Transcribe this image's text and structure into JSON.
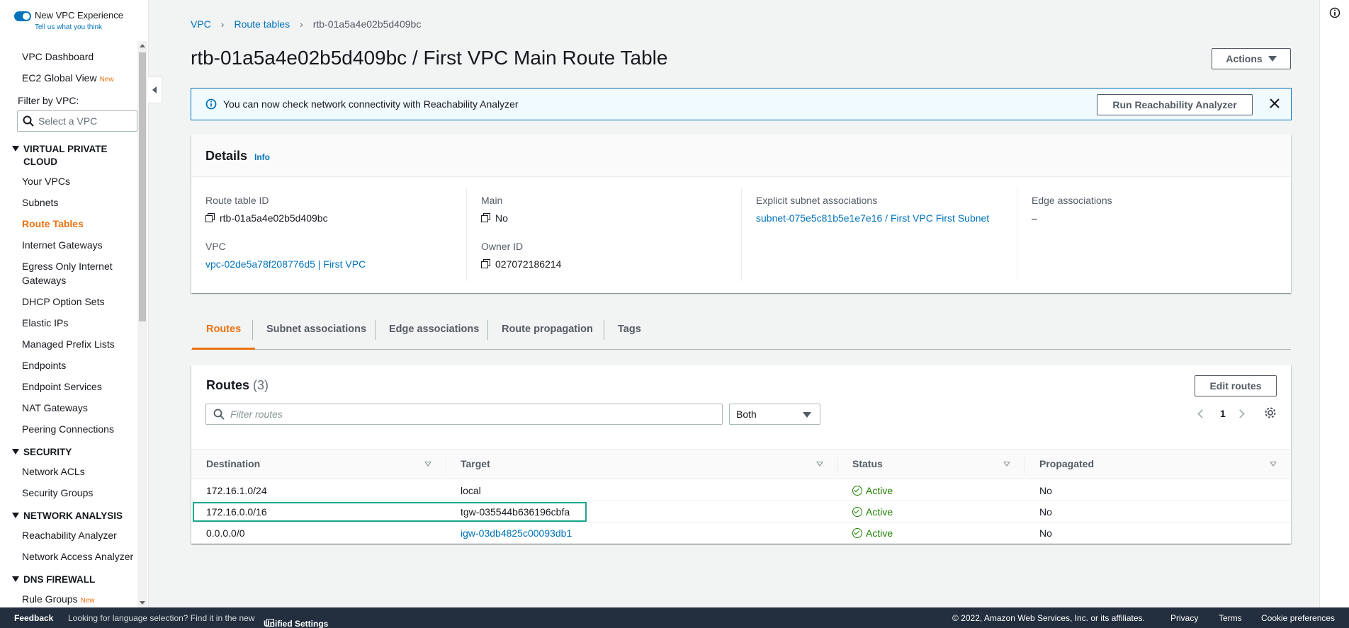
{
  "sidebar": {
    "toggle_label": "New VPC Experience",
    "toggle_sub": "Tell us what you think",
    "top_items": [
      {
        "label": "VPC Dashboard",
        "badge": ""
      },
      {
        "label": "EC2 Global View",
        "badge": "New"
      }
    ],
    "filter_label": "Filter by VPC:",
    "filter_placeholder": "Select a VPC",
    "sections": [
      {
        "title": "VIRTUAL PRIVATE CLOUD",
        "items": [
          "Your VPCs",
          "Subnets",
          "Route Tables",
          "Internet Gateways",
          "Egress Only Internet Gateways",
          "DHCP Option Sets",
          "Elastic IPs",
          "Managed Prefix Lists",
          "Endpoints",
          "Endpoint Services",
          "NAT Gateways",
          "Peering Connections"
        ]
      },
      {
        "title": "SECURITY",
        "items": [
          "Network ACLs",
          "Security Groups"
        ]
      },
      {
        "title": "NETWORK ANALYSIS",
        "items": [
          "Reachability Analyzer",
          "Network Access Analyzer"
        ]
      },
      {
        "title": "DNS FIREWALL",
        "items": [
          "Rule Groups"
        ]
      }
    ],
    "active_item": "Route Tables",
    "rule_groups_badge": "New"
  },
  "breadcrumb": [
    "VPC",
    "Route tables",
    "rtb-01a5a4e02b5d409bc"
  ],
  "page_title": "rtb-01a5a4e02b5d409bc / First VPC Main Route Table",
  "actions_label": "Actions",
  "flash": {
    "message": "You can now check network connectivity with Reachability Analyzer",
    "button": "Run Reachability Analyzer"
  },
  "details": {
    "title": "Details",
    "info": "Info",
    "route_table_id_label": "Route table ID",
    "route_table_id": "rtb-01a5a4e02b5d409bc",
    "vpc_label": "VPC",
    "vpc": "vpc-02de5a78f208776d5 | First VPC",
    "main_label": "Main",
    "main": "No",
    "owner_label": "Owner ID",
    "owner": "027072186214",
    "explicit_label": "Explicit subnet associations",
    "explicit": "subnet-075e5c81b5e1e7e16 / First VPC First Subnet",
    "edge_label": "Edge associations",
    "edge": "–"
  },
  "tabs": [
    "Routes",
    "Subnet associations",
    "Edge associations",
    "Route propagation",
    "Tags"
  ],
  "routes": {
    "title": "Routes",
    "count": "(3)",
    "edit_label": "Edit routes",
    "filter_placeholder": "Filter routes",
    "select_value": "Both",
    "page": "1",
    "columns": [
      "Destination",
      "Target",
      "Status",
      "Propagated"
    ],
    "rows": [
      {
        "destination": "172.16.1.0/24",
        "target": "local",
        "target_link": false,
        "status": "Active",
        "propagated": "No"
      },
      {
        "destination": "172.16.0.0/16",
        "target": "tgw-035544b636196cbfa",
        "target_link": false,
        "status": "Active",
        "propagated": "No"
      },
      {
        "destination": "0.0.0.0/0",
        "target": "igw-03db4825c00093db1",
        "target_link": true,
        "status": "Active",
        "propagated": "No"
      }
    ]
  },
  "footer": {
    "feedback": "Feedback",
    "lang": "Looking for language selection? Find it in the new",
    "unified": "Unified Settings",
    "copyright": "© 2022, Amazon Web Services, Inc. or its affiliates.",
    "privacy": "Privacy",
    "terms": "Terms",
    "cookies": "Cookie preferences"
  },
  "colors": {
    "accent": "#ec7211",
    "link": "#0073bb",
    "success": "#1d8102",
    "highlight": "#1aa68a",
    "footer": "#232f3e"
  }
}
